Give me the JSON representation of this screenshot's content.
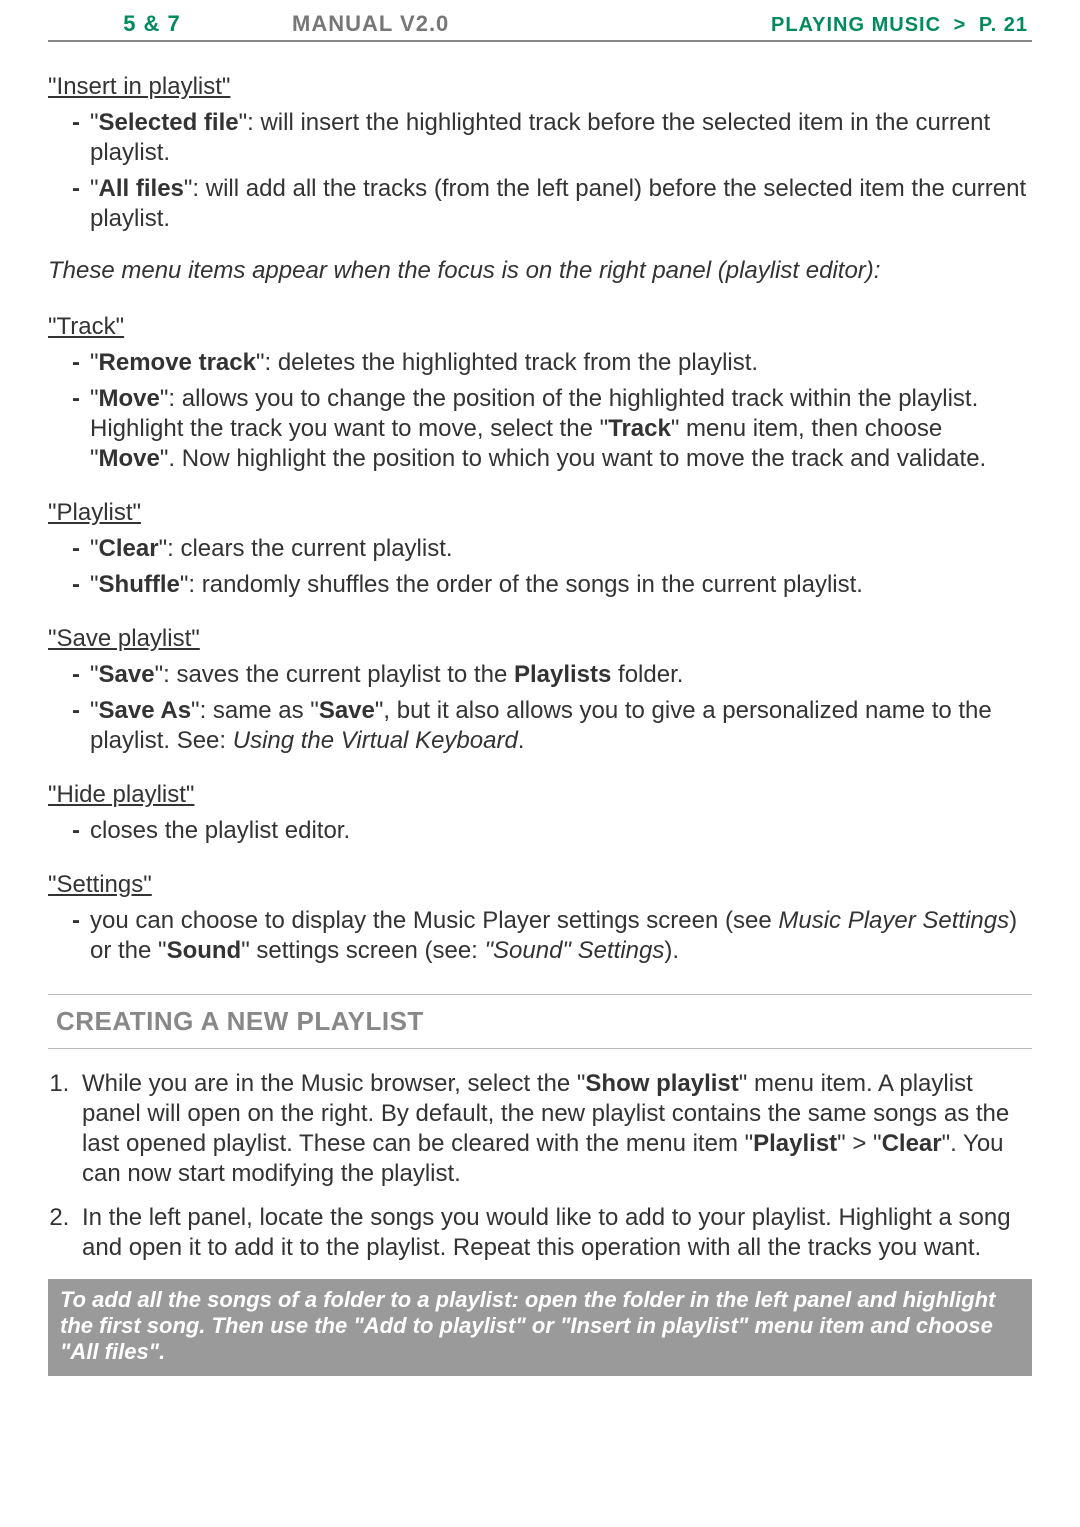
{
  "header": {
    "left": "5 & 7",
    "mid": "MANUAL V2.0",
    "right_section": "PLAYING MUSIC",
    "right_gt": ">",
    "right_page": "P. 21"
  },
  "insert_in_playlist": {
    "title": "\"Insert in playlist\"",
    "items": [
      {
        "term": "Selected file",
        "desc": ": will insert the highlighted track before the selected item in the current playlist."
      },
      {
        "term": "All files",
        "desc": ": will add all the tracks (from the left panel) before the selected item the current playlist."
      }
    ]
  },
  "note": "These menu items appear when the focus is on the right panel (playlist editor):",
  "track": {
    "title": "\"Track\"",
    "items": [
      {
        "term": "Remove track",
        "desc": ": deletes the highlighted track from the playlist."
      },
      {
        "term": "Move",
        "desc_pre": ": allows you to change the position of the highlighted track within the playlist. Highlight the track you want to move, select the \"",
        "desc_bold1": "Track",
        "desc_mid": "\" menu item, then choose \"",
        "desc_bold2": "Move",
        "desc_post": "\". Now highlight the position to which you want to move the track and validate."
      }
    ]
  },
  "playlist": {
    "title": "\"Playlist\"",
    "items": [
      {
        "term": "Clear",
        "desc": ": clears the current playlist."
      },
      {
        "term": "Shuffle",
        "desc": ": randomly shuffles the order of the songs in the current playlist."
      }
    ]
  },
  "save_playlist": {
    "title": "\"Save playlist\"",
    "items": [
      {
        "term": "Save",
        "desc_pre": ": saves the current playlist to the ",
        "desc_bold": "Playlists",
        "desc_post": " folder."
      },
      {
        "term": "Save As",
        "desc_pre": ": same as \"",
        "desc_bold": "Save",
        "desc_mid": "\", but it also allows you to give a personalized name to the playlist. See: ",
        "desc_ital": "Using the Virtual Keyboard",
        "desc_post": "."
      }
    ]
  },
  "hide_playlist": {
    "title": "\"Hide playlist\"",
    "item": "closes the playlist editor."
  },
  "settings": {
    "title": "\"Settings\"",
    "pre": "you can choose to display the Music Player settings screen (see ",
    "ital1": "Music Player Settings",
    "mid": ") or the \"",
    "bold": "Sound",
    "mid2": "\" settings screen (see: ",
    "ital2": "\"Sound\" Settings",
    "post": ")."
  },
  "h2": "CREATING A NEW PLAYLIST",
  "steps": [
    {
      "pre": "While you are in the Music browser, select the \"",
      "b1": "Show playlist",
      "mid1": "\" menu item. A playlist panel will open on the right. By default, the new playlist contains the same songs as the last opened playlist. These can be cleared with the menu item \"",
      "b2": "Playlist",
      "mid2": "\" > \"",
      "b3": "Clear",
      "post": "\". You can now start modifying the playlist."
    },
    {
      "text": "In the left panel, locate the songs you would like to add to your playlist. Highlight a song and open it to add it to the playlist. Repeat this operation with all the tracks you want."
    }
  ],
  "tip": "To add all the songs of a folder to a playlist: open the folder in the left panel and highlight the first song. Then use the \"Add to playlist\" or \"Insert in playlist\" menu item and choose \"All files\"."
}
